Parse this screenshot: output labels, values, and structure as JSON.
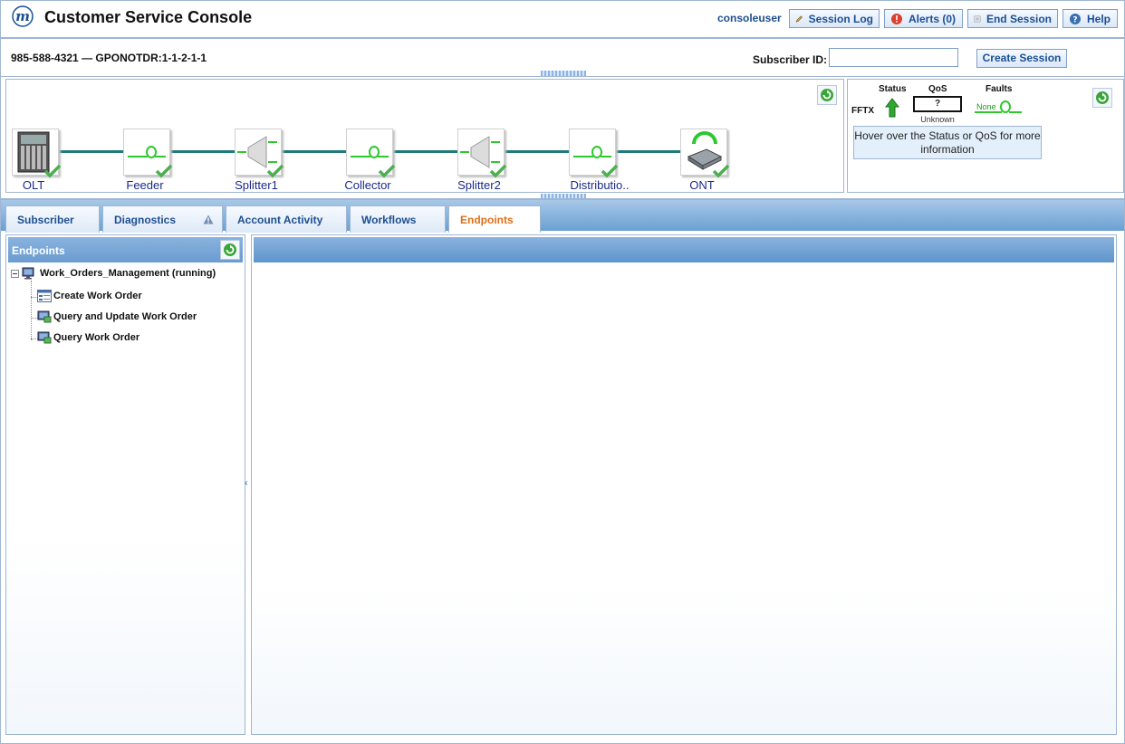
{
  "header": {
    "title": "Customer Service Console",
    "logo_letter": "m",
    "username": "consoleuser",
    "buttons": {
      "session_log": "Session Log",
      "alerts": "Alerts (0)",
      "end_session": "End Session",
      "help": "Help"
    }
  },
  "subscriber_bar": {
    "line": "985-588-4321 — GPONOTDR:1-1-2-1-1",
    "subscriber_id_label": "Subscriber ID:",
    "subscriber_id_value": "",
    "create_session": "Create Session"
  },
  "topology": {
    "nodes": [
      {
        "label": "OLT",
        "icon": "olt-chassis-icon"
      },
      {
        "label": "Feeder",
        "icon": "fiber-loop-icon"
      },
      {
        "label": "Splitter1",
        "icon": "splitter-icon"
      },
      {
        "label": "Collector",
        "icon": "fiber-loop-icon"
      },
      {
        "label": "Splitter2",
        "icon": "splitter-icon"
      },
      {
        "label": "Distributio..",
        "icon": "fiber-loop-icon"
      },
      {
        "label": "ONT",
        "icon": "ont-device-icon"
      }
    ]
  },
  "status_panel": {
    "status_label": "Status",
    "qos_label": "QoS",
    "faults_label": "Faults",
    "service": "FFTX",
    "qos_value": "?",
    "qos_state": "Unknown",
    "faults_value": "None",
    "hint": "Hover over the Status or QoS for more information"
  },
  "tabs": [
    {
      "label": "Subscriber"
    },
    {
      "label": "Diagnostics"
    },
    {
      "label": "Account Activity"
    },
    {
      "label": "Workflows"
    },
    {
      "label": "Endpoints"
    }
  ],
  "endpoints": {
    "title": "Endpoints",
    "tree": {
      "root": "Work_Orders_Management (running)",
      "children": [
        "Create Work Order",
        "Query and Update Work Order",
        "Query Work Order"
      ]
    }
  },
  "colors": {
    "accent": "#1a4f96",
    "active_tab": "#e0701a",
    "link_line": "#1f7a7a",
    "ok_check": "#4caf50"
  }
}
